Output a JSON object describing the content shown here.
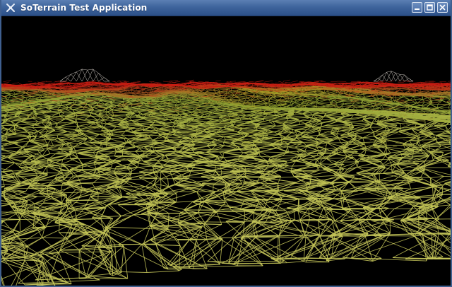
{
  "window": {
    "title": "SoTerrain Test Application",
    "icons": {
      "app": "app-icon",
      "minimize": "minimize-icon",
      "maximize": "maximize-icon",
      "close": "close-icon"
    }
  },
  "viewport": {
    "content": "3d-wireframe-terrain",
    "colors": {
      "background": "#000000",
      "near": "#c8c85a",
      "mid": "#8ea032",
      "far": "#c81e14",
      "peak": "#e8e0d8"
    }
  }
}
